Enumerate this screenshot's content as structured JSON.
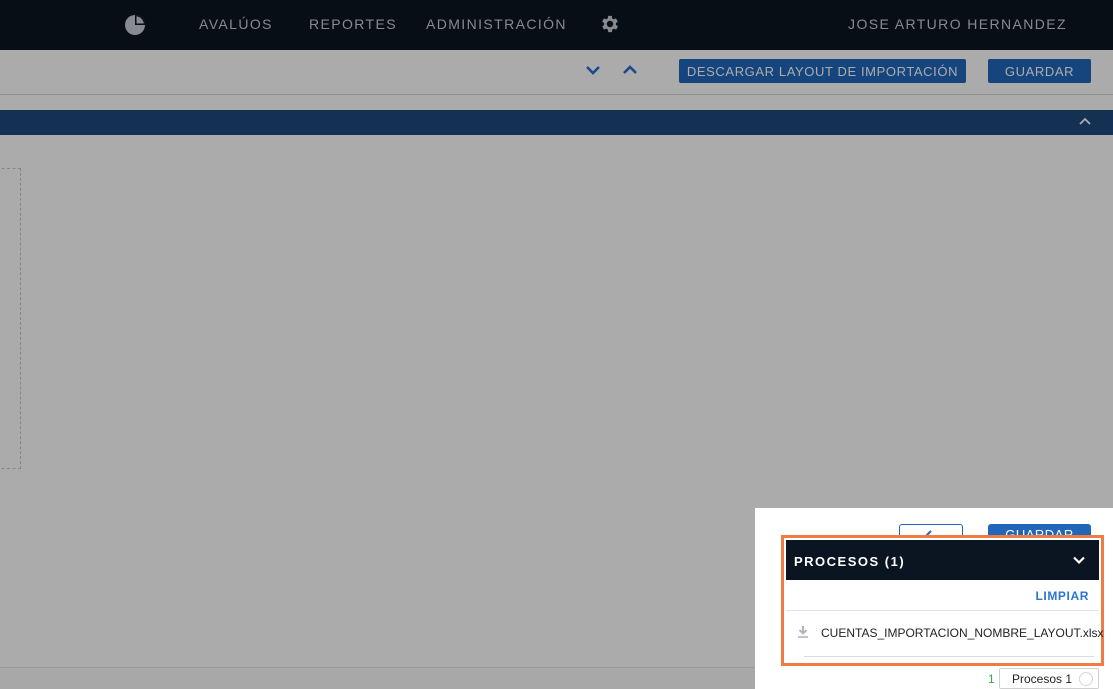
{
  "nav": {
    "items": [
      "AVALÚOS",
      "REPORTES",
      "ADMINISTRACIÓN"
    ],
    "user": "JOSE ARTURO HERNANDEZ"
  },
  "toolbar": {
    "download_layout_label": "DESCARGAR LAYOUT DE IMPORTACIÓN",
    "save_label": "GUARDAR"
  },
  "modal": {
    "save_label": "GUARDAR"
  },
  "processes": {
    "title": "PROCESOS (1)",
    "clear_label": "LIMPIAR",
    "files": [
      {
        "name": "CUENTAS_IMPORTACION_NOMBRE_LAYOUT.xlsx"
      }
    ]
  },
  "tray": {
    "count": "1",
    "label": "Procesos 1"
  },
  "colors": {
    "nav_bg": "#0b1522",
    "primary": "#2266bb",
    "section_bar": "#1f4a7c",
    "highlight_border": "#ef7b45",
    "link": "#2a77d0",
    "tray_count": "#3aa64a"
  }
}
